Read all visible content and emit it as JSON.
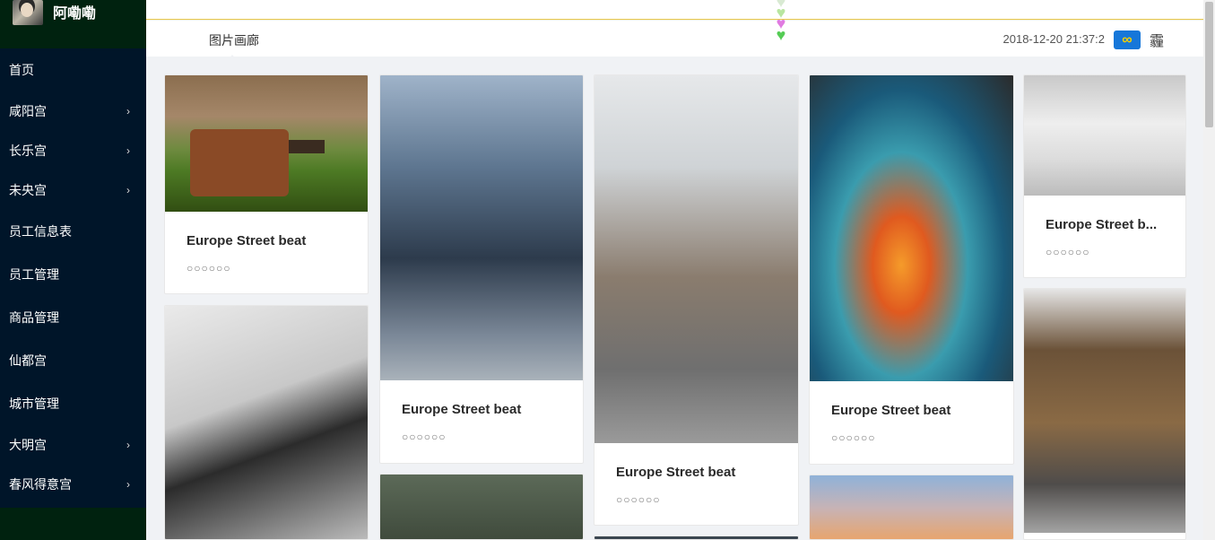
{
  "user": {
    "name": "阿嘞嘞"
  },
  "sidebar": {
    "items": [
      {
        "label": "首页",
        "has_children": false
      },
      {
        "label": "咸阳宫",
        "has_children": true
      },
      {
        "label": "长乐宫",
        "has_children": true
      },
      {
        "label": "未央宫",
        "has_children": true
      },
      {
        "label": "员工信息表",
        "has_children": false
      },
      {
        "label": "员工管理",
        "has_children": false
      },
      {
        "label": "商品管理",
        "has_children": false
      },
      {
        "label": "仙都宫",
        "has_children": false
      },
      {
        "label": "城市管理",
        "has_children": false
      },
      {
        "label": "大明宫",
        "has_children": true
      },
      {
        "label": "春风得意宫",
        "has_children": true
      }
    ],
    "chevron": "›"
  },
  "header": {
    "breadcrumb": "图片画廊",
    "datetime": "2018-12-20 21:37:2",
    "badge_glyph": "∞",
    "right_glyph": "霾",
    "heart_glyph": "♥",
    "heart_colors": [
      "#d9ead3",
      "#b8e6a0",
      "#e07be0",
      "#55cc55"
    ]
  },
  "gallery": {
    "cards": [
      {
        "title": "Europe Street beat",
        "desc": "○○○○○○",
        "image": "forest-suitcase-photo"
      },
      {
        "title": "Europe Street beat",
        "desc": "○○○○○○",
        "image": "helicopter-woman-photo"
      },
      {
        "title": "Europe Street beat",
        "desc": "○○○○○○",
        "image": "japanese-street-photo"
      },
      {
        "title": "Europe Street beat",
        "desc": "○○○○○○",
        "image": "ocean-wave-sunset-photo"
      },
      {
        "title": "Europe Street b...",
        "desc": "○○○○○○",
        "image": "snowy-jeep-photo"
      },
      {
        "title": "",
        "desc": "",
        "image": "crow-illustration"
      },
      {
        "title": "",
        "desc": "",
        "image": "blurred-green-photo"
      },
      {
        "title": "",
        "desc": "",
        "image": "mountain-road-skater-photo"
      },
      {
        "title": "",
        "desc": "",
        "image": "sunset-clouds-photo"
      },
      {
        "title": "",
        "desc": "",
        "image": "dark-photo"
      }
    ]
  },
  "colors": {
    "sidebar_bg": "#001529",
    "sidebar_accent_bg": "#00220f",
    "content_bg": "#f0f2f5",
    "header_rule": "#e8c84a",
    "badge_bg": "#1677d9"
  }
}
